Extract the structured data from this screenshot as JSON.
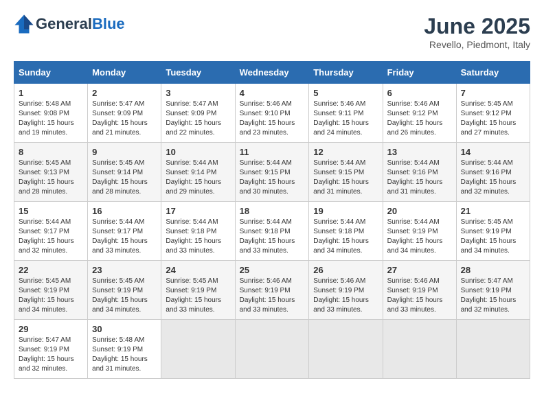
{
  "header": {
    "logo_general": "General",
    "logo_blue": "Blue",
    "month_title": "June 2025",
    "location": "Revello, Piedmont, Italy"
  },
  "weekdays": [
    "Sunday",
    "Monday",
    "Tuesday",
    "Wednesday",
    "Thursday",
    "Friday",
    "Saturday"
  ],
  "weeks": [
    [
      {
        "day": 1,
        "sunrise": "5:48 AM",
        "sunset": "9:08 PM",
        "daylight": "15 hours and 19 minutes."
      },
      {
        "day": 2,
        "sunrise": "5:47 AM",
        "sunset": "9:09 PM",
        "daylight": "15 hours and 21 minutes."
      },
      {
        "day": 3,
        "sunrise": "5:47 AM",
        "sunset": "9:09 PM",
        "daylight": "15 hours and 22 minutes."
      },
      {
        "day": 4,
        "sunrise": "5:46 AM",
        "sunset": "9:10 PM",
        "daylight": "15 hours and 23 minutes."
      },
      {
        "day": 5,
        "sunrise": "5:46 AM",
        "sunset": "9:11 PM",
        "daylight": "15 hours and 24 minutes."
      },
      {
        "day": 6,
        "sunrise": "5:46 AM",
        "sunset": "9:12 PM",
        "daylight": "15 hours and 26 minutes."
      },
      {
        "day": 7,
        "sunrise": "5:45 AM",
        "sunset": "9:12 PM",
        "daylight": "15 hours and 27 minutes."
      }
    ],
    [
      {
        "day": 8,
        "sunrise": "5:45 AM",
        "sunset": "9:13 PM",
        "daylight": "15 hours and 28 minutes."
      },
      {
        "day": 9,
        "sunrise": "5:45 AM",
        "sunset": "9:14 PM",
        "daylight": "15 hours and 28 minutes."
      },
      {
        "day": 10,
        "sunrise": "5:44 AM",
        "sunset": "9:14 PM",
        "daylight": "15 hours and 29 minutes."
      },
      {
        "day": 11,
        "sunrise": "5:44 AM",
        "sunset": "9:15 PM",
        "daylight": "15 hours and 30 minutes."
      },
      {
        "day": 12,
        "sunrise": "5:44 AM",
        "sunset": "9:15 PM",
        "daylight": "15 hours and 31 minutes."
      },
      {
        "day": 13,
        "sunrise": "5:44 AM",
        "sunset": "9:16 PM",
        "daylight": "15 hours and 31 minutes."
      },
      {
        "day": 14,
        "sunrise": "5:44 AM",
        "sunset": "9:16 PM",
        "daylight": "15 hours and 32 minutes."
      }
    ],
    [
      {
        "day": 15,
        "sunrise": "5:44 AM",
        "sunset": "9:17 PM",
        "daylight": "15 hours and 32 minutes."
      },
      {
        "day": 16,
        "sunrise": "5:44 AM",
        "sunset": "9:17 PM",
        "daylight": "15 hours and 33 minutes."
      },
      {
        "day": 17,
        "sunrise": "5:44 AM",
        "sunset": "9:18 PM",
        "daylight": "15 hours and 33 minutes."
      },
      {
        "day": 18,
        "sunrise": "5:44 AM",
        "sunset": "9:18 PM",
        "daylight": "15 hours and 33 minutes."
      },
      {
        "day": 19,
        "sunrise": "5:44 AM",
        "sunset": "9:18 PM",
        "daylight": "15 hours and 34 minutes."
      },
      {
        "day": 20,
        "sunrise": "5:44 AM",
        "sunset": "9:19 PM",
        "daylight": "15 hours and 34 minutes."
      },
      {
        "day": 21,
        "sunrise": "5:45 AM",
        "sunset": "9:19 PM",
        "daylight": "15 hours and 34 minutes."
      }
    ],
    [
      {
        "day": 22,
        "sunrise": "5:45 AM",
        "sunset": "9:19 PM",
        "daylight": "15 hours and 34 minutes."
      },
      {
        "day": 23,
        "sunrise": "5:45 AM",
        "sunset": "9:19 PM",
        "daylight": "15 hours and 34 minutes."
      },
      {
        "day": 24,
        "sunrise": "5:45 AM",
        "sunset": "9:19 PM",
        "daylight": "15 hours and 33 minutes."
      },
      {
        "day": 25,
        "sunrise": "5:46 AM",
        "sunset": "9:19 PM",
        "daylight": "15 hours and 33 minutes."
      },
      {
        "day": 26,
        "sunrise": "5:46 AM",
        "sunset": "9:19 PM",
        "daylight": "15 hours and 33 minutes."
      },
      {
        "day": 27,
        "sunrise": "5:46 AM",
        "sunset": "9:19 PM",
        "daylight": "15 hours and 33 minutes."
      },
      {
        "day": 28,
        "sunrise": "5:47 AM",
        "sunset": "9:19 PM",
        "daylight": "15 hours and 32 minutes."
      }
    ],
    [
      {
        "day": 29,
        "sunrise": "5:47 AM",
        "sunset": "9:19 PM",
        "daylight": "15 hours and 32 minutes."
      },
      {
        "day": 30,
        "sunrise": "5:48 AM",
        "sunset": "9:19 PM",
        "daylight": "15 hours and 31 minutes."
      },
      null,
      null,
      null,
      null,
      null
    ]
  ]
}
